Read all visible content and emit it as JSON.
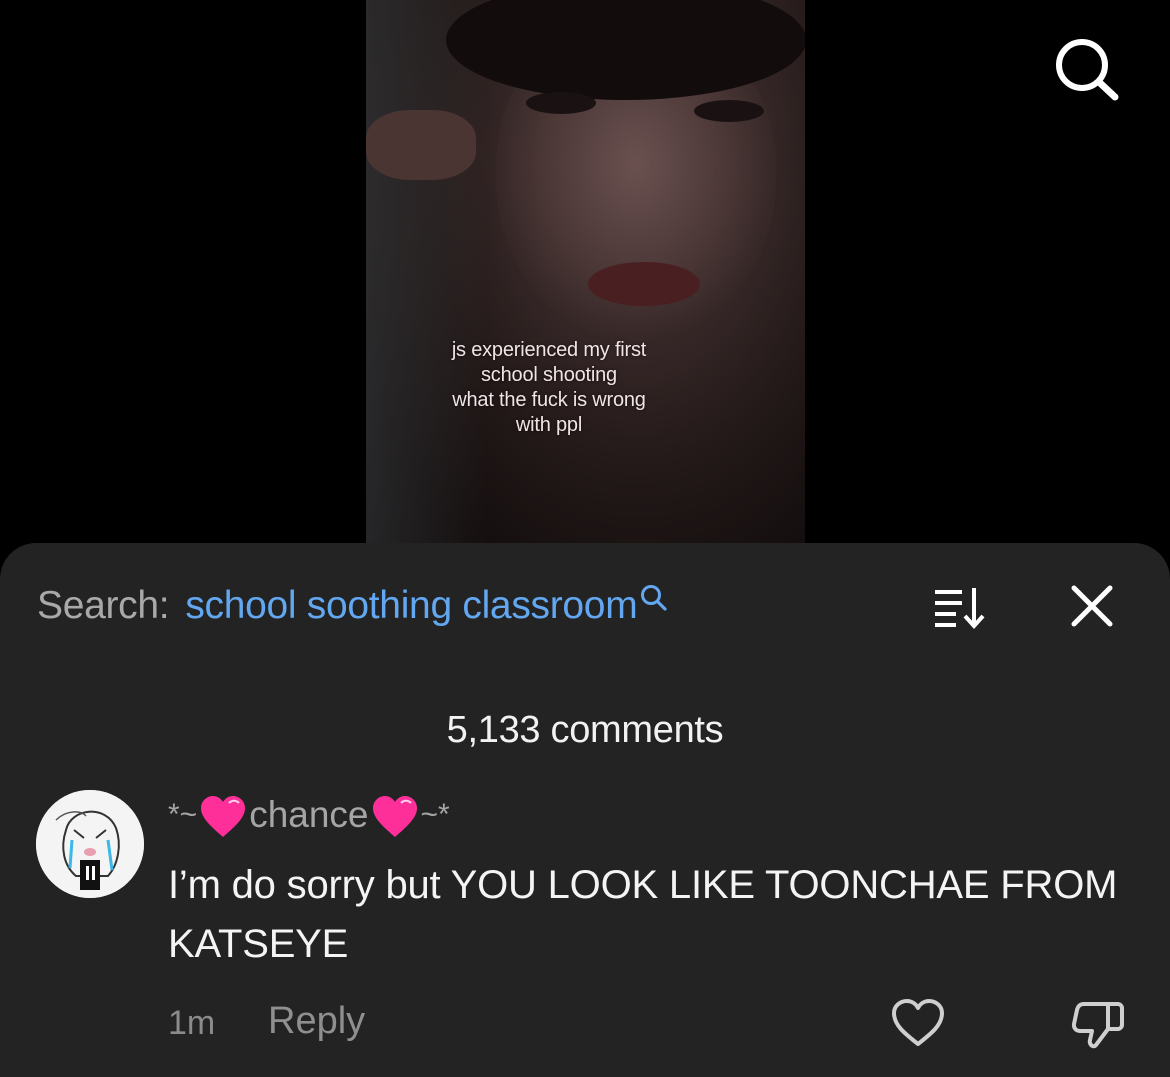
{
  "video": {
    "caption_lines": [
      "js experienced my first",
      "school shooting",
      "what the fuck is wrong",
      "with ppl"
    ]
  },
  "top_bar": {
    "search_icon": "search-icon"
  },
  "comment_sheet": {
    "search_prefix": "Search:",
    "search_query": "school soothing classroom",
    "comment_count": "5,133 comments",
    "sort_icon": "sort-icon",
    "close_icon": "close-icon"
  },
  "comments": [
    {
      "username_prefix": "*~",
      "username_name": "chance",
      "username_suffix": "~*",
      "text": "I’m do sorry but YOU LOOK LIKE TOONCHAE FROM KATSEYE",
      "time": "1m",
      "reply_label": "Reply",
      "heart_color": "#ff2f9a"
    }
  ],
  "colors": {
    "sheet_bg": "#232323",
    "accent_blue": "#62a7f0",
    "muted_text": "#a5a5a5"
  }
}
